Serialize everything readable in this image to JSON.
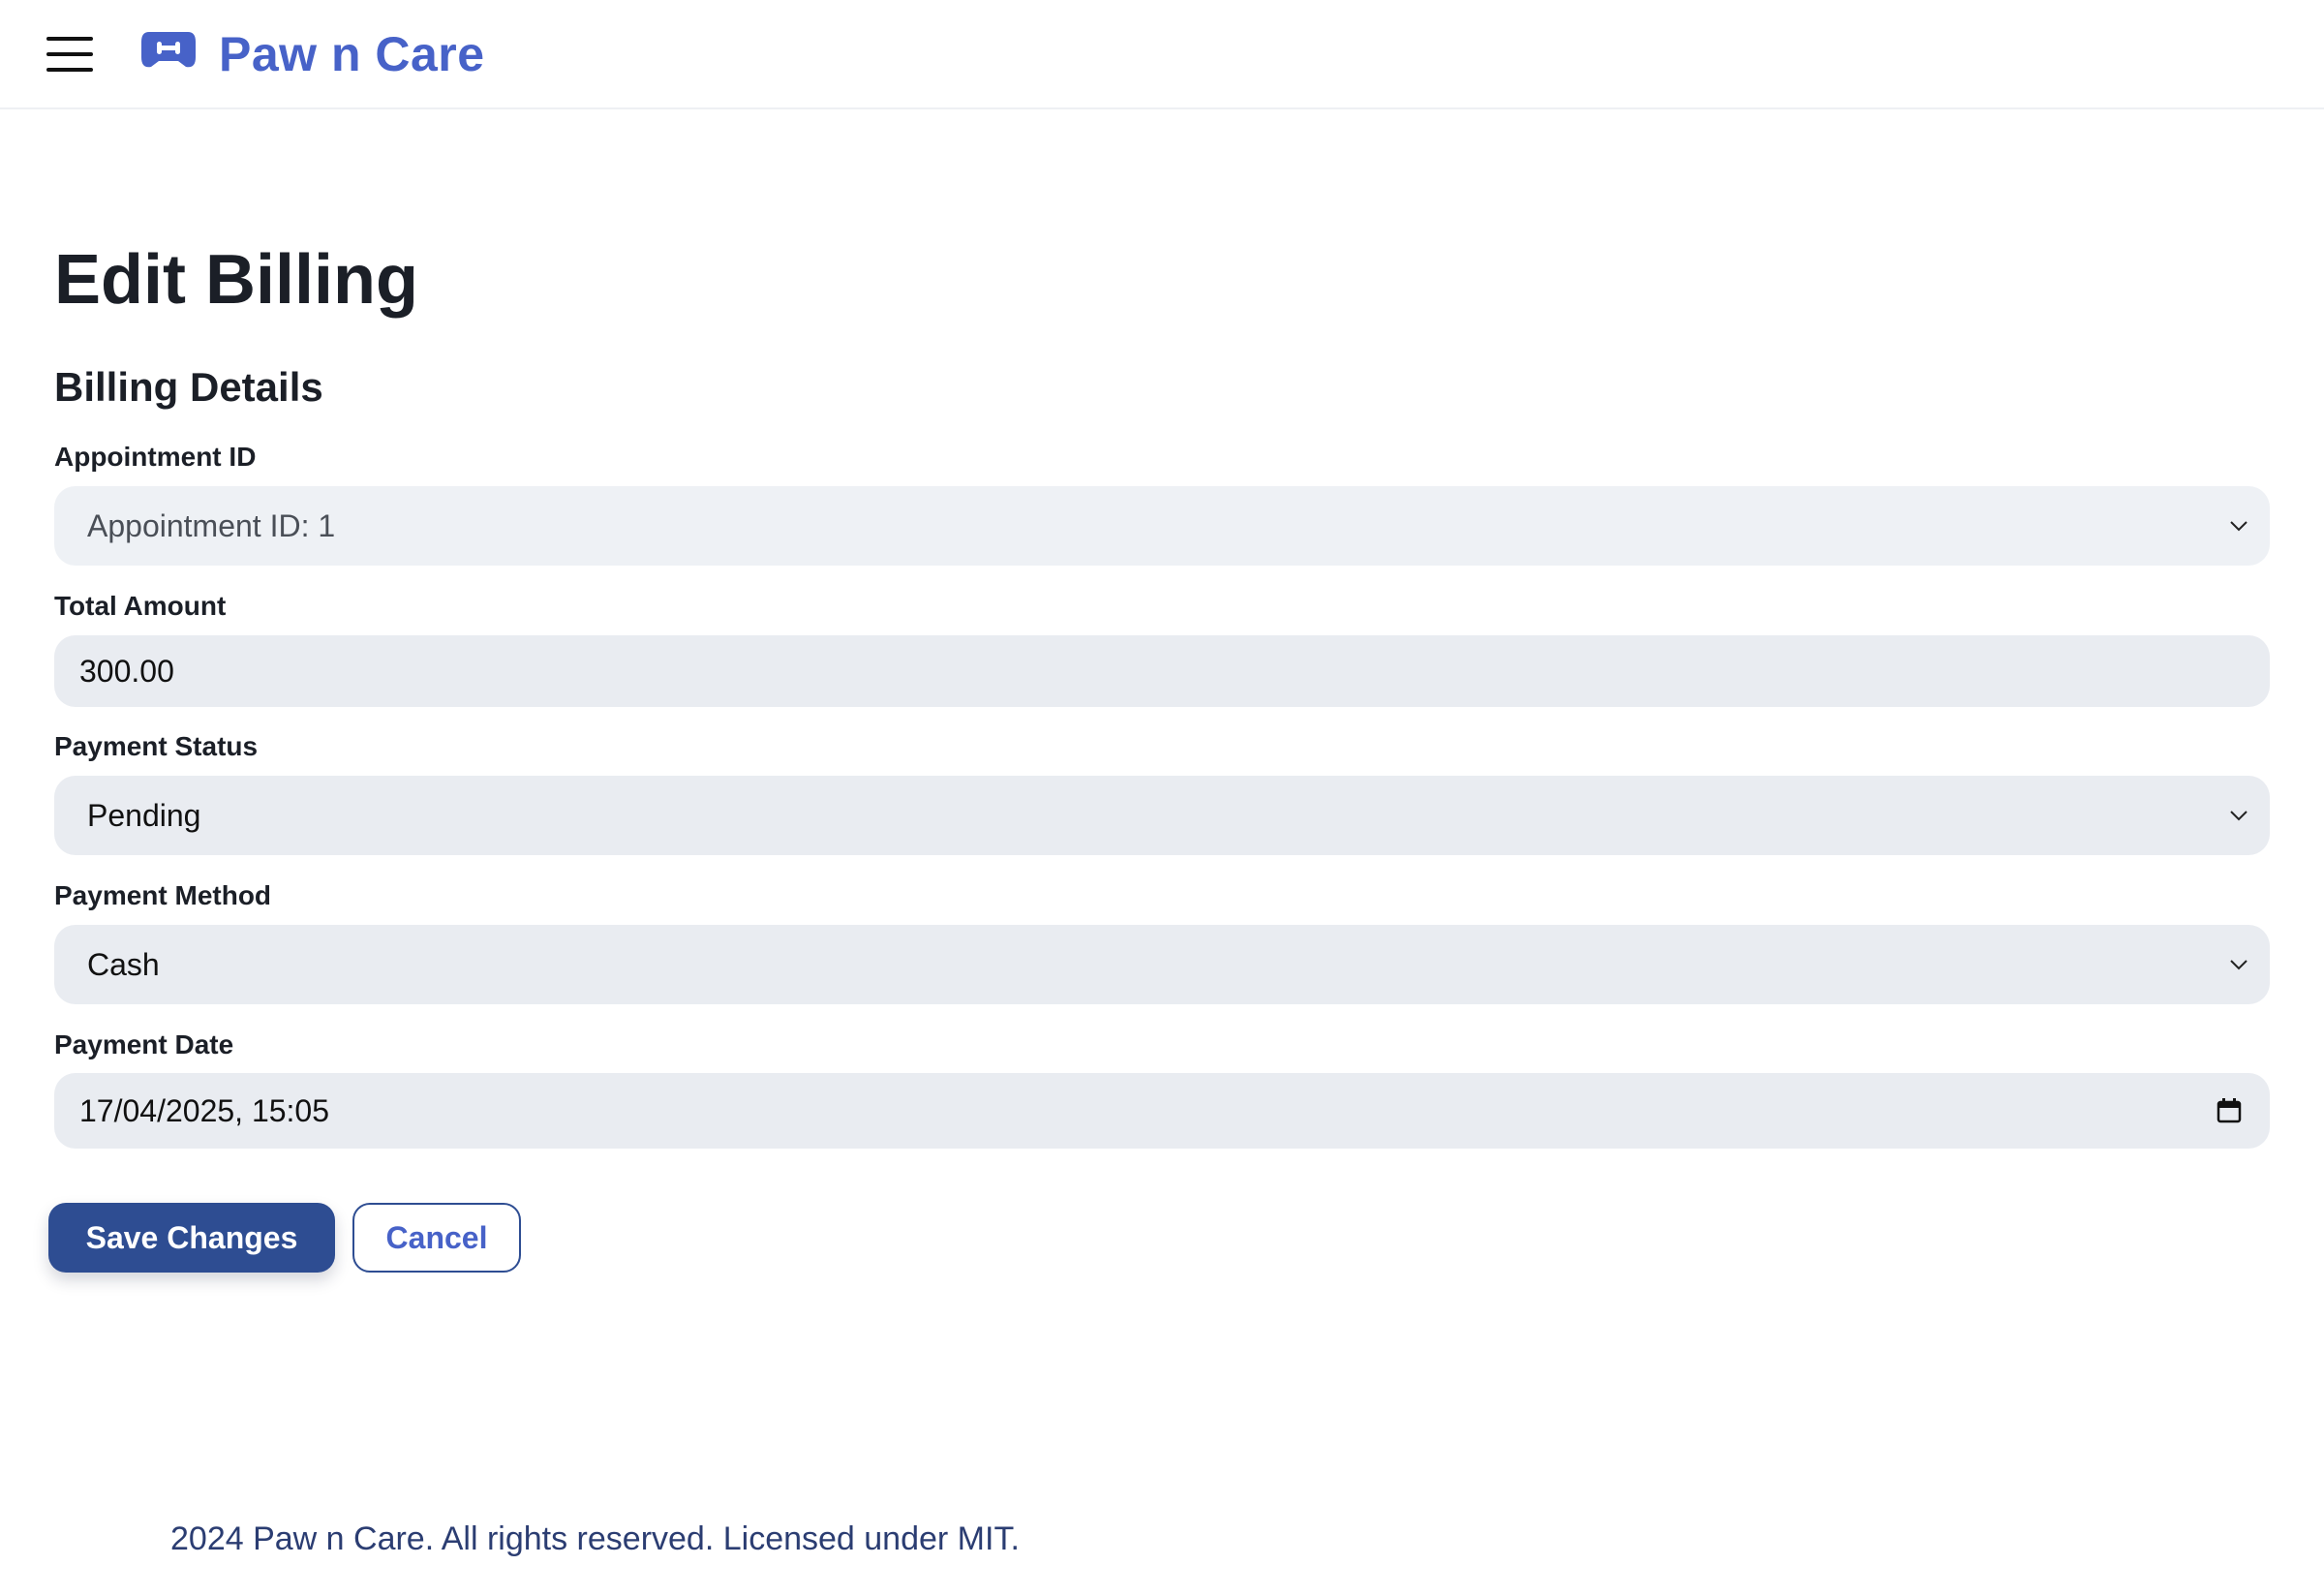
{
  "header": {
    "brand_name": "Paw n Care",
    "brand_color": "#4762c8",
    "menu_icon": "hamburger-menu-icon",
    "logo_icon": "gamepad-paw-icon"
  },
  "main": {
    "title": "Edit Billing",
    "section_title": "Billing Details",
    "fields": {
      "appointment": {
        "label": "Appointment ID",
        "value": "Appointment ID: 1",
        "type": "select"
      },
      "total_amount": {
        "label": "Total Amount",
        "value": "300.00",
        "type": "number"
      },
      "payment_status": {
        "label": "Payment Status",
        "value": "Pending",
        "type": "select"
      },
      "payment_method": {
        "label": "Payment Method",
        "value": "Cash",
        "type": "select"
      },
      "payment_date": {
        "label": "Payment Date",
        "value": "17/04/2025, 15:05",
        "type": "datetime"
      }
    },
    "buttons": {
      "save": "Save Changes",
      "cancel": "Cancel"
    }
  },
  "footer": {
    "text": "2024 Paw n Care. All rights reserved. Licensed under MIT."
  },
  "colors": {
    "primary": "#2e4d92",
    "field_bg": "#e9ecf1"
  }
}
